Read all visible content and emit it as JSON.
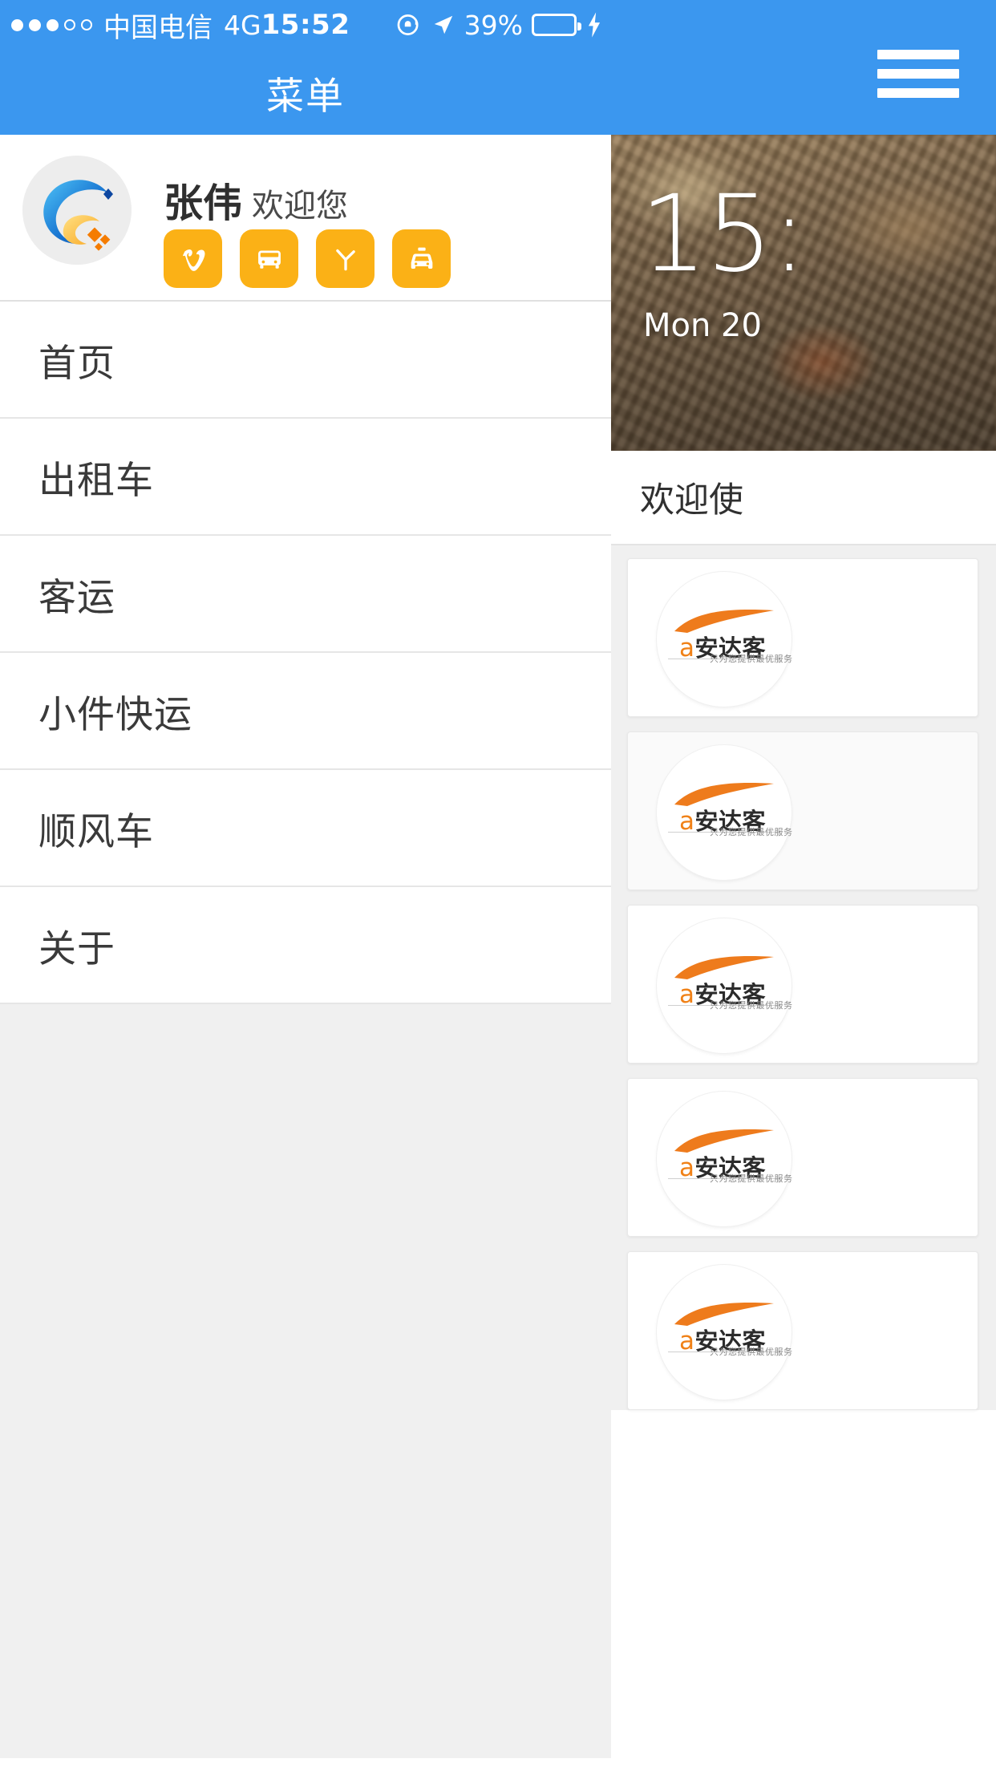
{
  "status_bar": {
    "signal_dots_filled": 3,
    "signal_dots_empty": 2,
    "carrier": "中国电信",
    "network": "4G",
    "time": "15:52",
    "battery_percent": "39%",
    "battery_level": 39,
    "icons": [
      "rotation-lock-icon",
      "location-arrow-icon",
      "battery-icon",
      "charging-bolt-icon"
    ],
    "battery_fill_color": "#4cd964"
  },
  "theme": {
    "accent_blue": "#3b97ef",
    "quick_icon_orange": "#fbb116",
    "logo_orange": "#f08117"
  },
  "sidebar": {
    "navbar_title": "菜单",
    "profile": {
      "user_name": "张伟",
      "welcome_suffix": "欢迎您",
      "avatar_icon": "company-logo-avatar"
    },
    "quick_actions": [
      {
        "icon": "v-logo-icon",
        "name": "quick-action-v"
      },
      {
        "icon": "bus-icon",
        "name": "quick-action-bus"
      },
      {
        "icon": "branch-icon",
        "name": "quick-action-branch"
      },
      {
        "icon": "taxi-icon",
        "name": "quick-action-taxi"
      }
    ],
    "menu_items": [
      {
        "label": "首页",
        "name": "menu-item-home"
      },
      {
        "label": "出租车",
        "name": "menu-item-taxi"
      },
      {
        "label": "客运",
        "name": "menu-item-passenger-transport"
      },
      {
        "label": "小件快运",
        "name": "menu-item-small-parcel"
      },
      {
        "label": "顺风车",
        "name": "menu-item-carpool"
      },
      {
        "label": "关于",
        "name": "menu-item-about"
      }
    ]
  },
  "main_panel": {
    "hamburger_icon": "hamburger-menu-icon",
    "hero": {
      "time": "15:",
      "date": "Mon 20",
      "background": "city-aerial-photo"
    },
    "welcome_text": "欢迎使",
    "cards": [
      {
        "logo_letter": "a",
        "logo_name": "安达客",
        "tagline": "只为您提供最优服务"
      },
      {
        "logo_letter": "a",
        "logo_name": "安达客",
        "tagline": "只为您提供最优服务"
      },
      {
        "logo_letter": "a",
        "logo_name": "安达客",
        "tagline": "只为您提供最优服务"
      },
      {
        "logo_letter": "a",
        "logo_name": "安达客",
        "tagline": "只为您提供最优服务"
      },
      {
        "logo_letter": "a",
        "logo_name": "安达客",
        "tagline": "只为您提供最优服务"
      }
    ]
  }
}
